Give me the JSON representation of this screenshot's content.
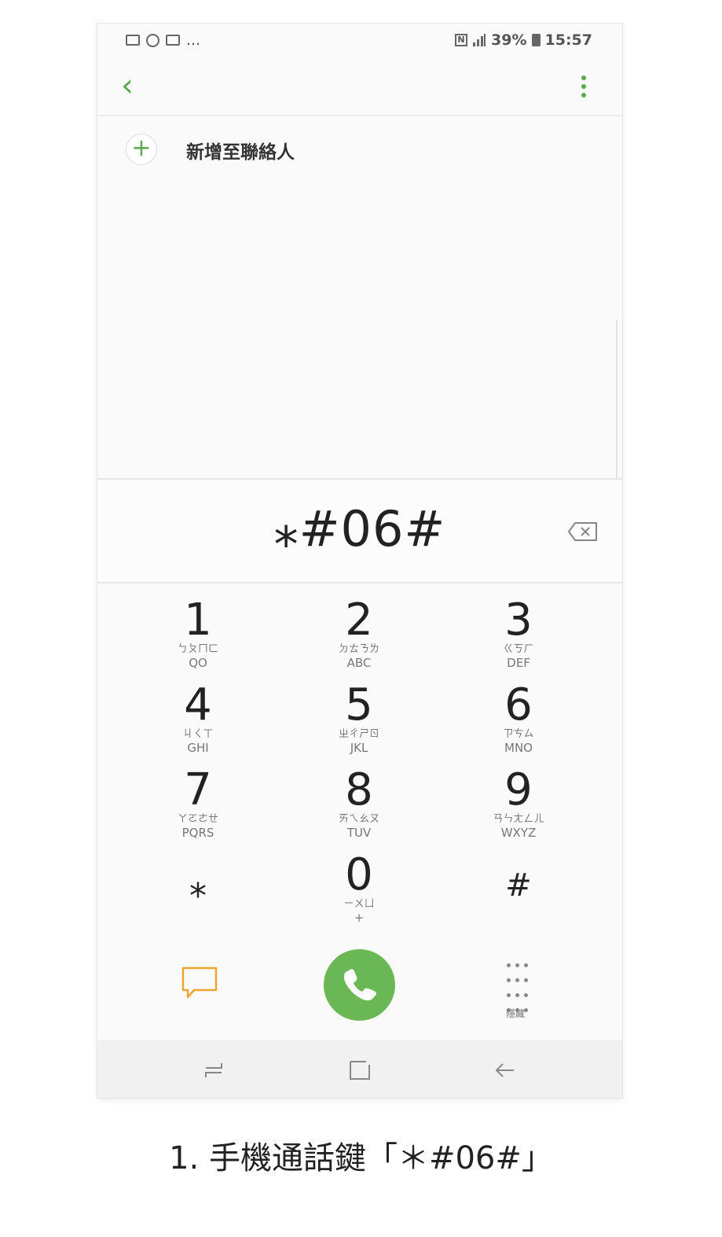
{
  "status_bar": {
    "battery": "39%",
    "time": "15:57",
    "more": "..."
  },
  "add_contact_label": "新增至聯絡人",
  "dialed_number": "⁎#06#",
  "keys": [
    {
      "digit": "1",
      "bopomofo": "ㄅㄆㄇㄈ",
      "letters": "QO"
    },
    {
      "digit": "2",
      "bopomofo": "ㄉㄊㄋㄌ",
      "letters": "ABC"
    },
    {
      "digit": "3",
      "bopomofo": "ㄍㄎㄏ",
      "letters": "DEF"
    },
    {
      "digit": "4",
      "bopomofo": "ㄐㄑㄒ",
      "letters": "GHI"
    },
    {
      "digit": "5",
      "bopomofo": "ㄓㄔㄕㄖ",
      "letters": "JKL"
    },
    {
      "digit": "6",
      "bopomofo": "ㄗㄘㄙ",
      "letters": "MNO"
    },
    {
      "digit": "7",
      "bopomofo": "ㄚㄛㄜㄝ",
      "letters": "PQRS"
    },
    {
      "digit": "8",
      "bopomofo": "ㄞㄟㄠㄡ",
      "letters": "TUV"
    },
    {
      "digit": "9",
      "bopomofo": "ㄢㄣㄤㄥㄦ",
      "letters": "WXYZ"
    },
    {
      "digit": "⁎",
      "bopomofo": "",
      "letters": ""
    },
    {
      "digit": "0",
      "bopomofo": "ㄧㄨㄩ",
      "letters": "+"
    },
    {
      "digit": "#",
      "bopomofo": "",
      "letters": ""
    }
  ],
  "hide_keypad_label": "隱藏",
  "caption": "1. 手機通話鍵「＊#06#」",
  "colors": {
    "accent": "#5aa94b",
    "call_button": "#6ab855",
    "message_icon": "#f0a532"
  },
  "icons": [
    "gallery-icon",
    "sync-icon",
    "mail-icon",
    "nfc-icon",
    "signal-icon",
    "battery-icon",
    "back-arrow-icon",
    "more-vert-icon",
    "plus-icon",
    "backspace-icon",
    "message-icon",
    "phone-icon",
    "keypad-grid-icon",
    "recents-icon",
    "home-icon",
    "nav-back-icon"
  ]
}
